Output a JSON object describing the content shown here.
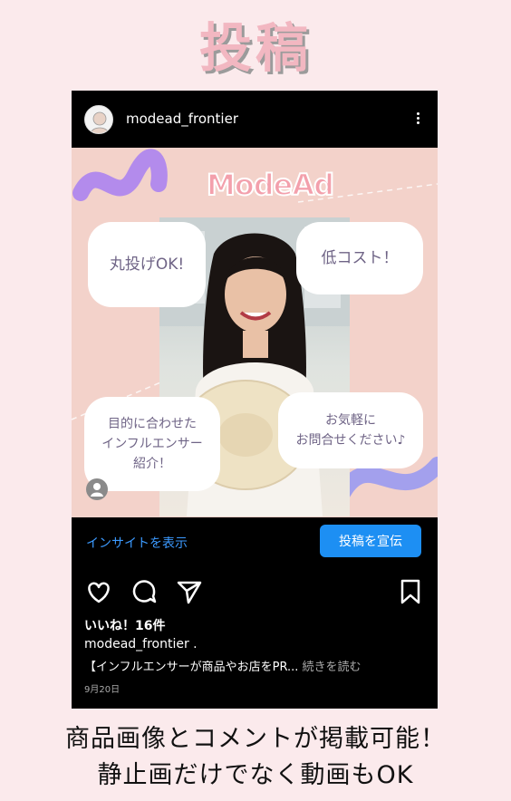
{
  "page": {
    "heading": "投稿",
    "footer_line1": "商品画像とコメントが掲載可能！",
    "footer_line2": "静止画だけでなく動画もOK"
  },
  "post": {
    "username": "modead_frontier",
    "logo": "ModeAd",
    "bubbles": {
      "b1": "丸投げOK!",
      "b2": "低コスト！",
      "b3_line1": "目的に合わせた",
      "b3_line2": "インフルエンサー",
      "b3_line3": "紹介！",
      "b4_line1": "お気軽に",
      "b4_line2": "お問合せください♪"
    },
    "insights_label": "インサイトを表示",
    "promote_label": "投稿を宣伝",
    "likes": "いいね！16件",
    "caption_user": "modead_frontier .",
    "caption_text": "【インフルエンサーが商品やお店をPR...",
    "caption_more": " 続きを読む",
    "date": "9月20日"
  },
  "icons": {
    "more": "more-vertical-icon",
    "like": "heart-icon",
    "comment": "comment-icon",
    "share": "send-icon",
    "save": "bookmark-icon"
  },
  "colors": {
    "background": "#fbeaec",
    "accent_pink": "#f2b7c1",
    "promote_blue": "#1d8ff3",
    "insights_blue": "#3c9aff"
  }
}
